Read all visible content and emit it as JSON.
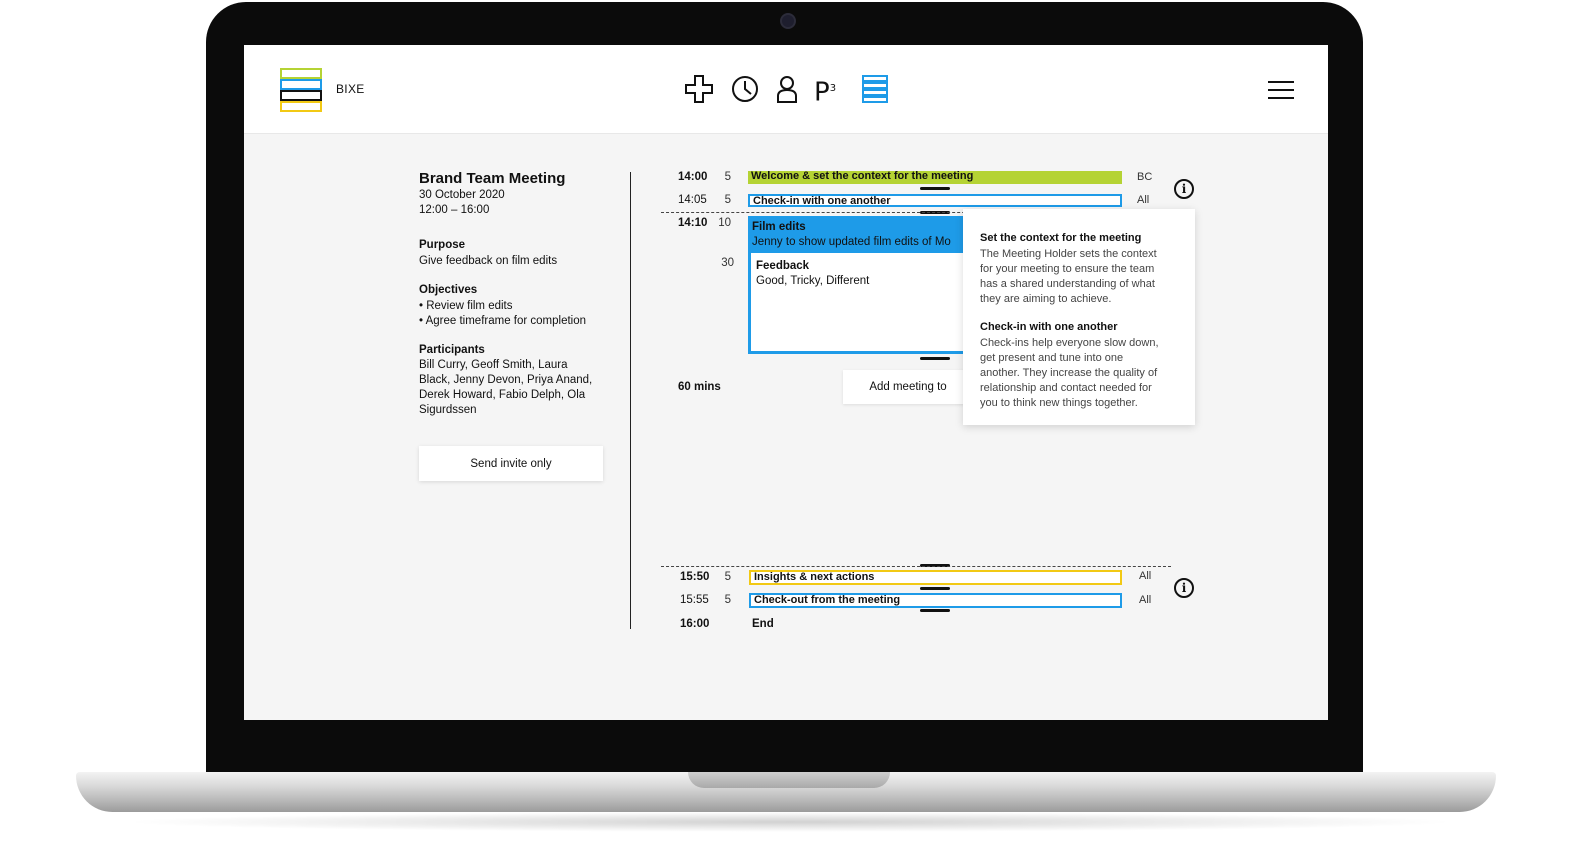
{
  "app": {
    "brand": "BIXE"
  },
  "nav": {
    "icons": [
      "plus-icon",
      "clock-icon",
      "person-icon",
      "p3-icon",
      "agenda-list-icon",
      "menu-icon"
    ],
    "p3_label": "P",
    "p3_sup": "3"
  },
  "meeting": {
    "title": "Brand Team Meeting",
    "date": "30 October 2020",
    "time_range": "12:00 – 16:00",
    "purpose_label": "Purpose",
    "purpose": "Give feedback on film edits",
    "objectives_label": "Objectives",
    "objectives": [
      "• Review film edits",
      "• Agree timeframe for completion"
    ],
    "participants_label": "Participants",
    "participants_lines": [
      "Bill Curry, Geoff Smith, Laura",
      "Black, Jenny Devon, Priya Anand,",
      "Derek Howard, Fabio Delph, Ola",
      "Sigurdssen"
    ],
    "send_invite": "Send invite only"
  },
  "agenda": {
    "items": [
      {
        "time": "14:00",
        "duration": "5",
        "title": "Welcome & set the context for the meeting",
        "who": "BC",
        "color": "#b5d334"
      },
      {
        "time": "14:05",
        "duration": "5",
        "title": "Check-in with one another",
        "who": "All",
        "color": "#1e9be8"
      }
    ],
    "film": {
      "time": "14:10",
      "duration": "10",
      "title": "Film edits",
      "subtitle": "Jenny to show updated film edits of Mo",
      "feedback_duration": "30",
      "feedback_title": "Feedback",
      "feedback_text": "Good, Tricky, Different"
    },
    "total": "60 mins",
    "add_button": "Add meeting to",
    "closing": [
      {
        "time": "15:50",
        "duration": "5",
        "title": "Insights & next actions",
        "who": "All",
        "color": "#f2c914"
      },
      {
        "time": "15:55",
        "duration": "5",
        "title": "Check-out from the meeting",
        "who": "All",
        "color": "#1e9be8"
      }
    ],
    "end_time": "16:00",
    "end_label": "End"
  },
  "tooltip": {
    "sections": [
      {
        "title": "Set the context for the meeting",
        "lines": [
          "The Meeting Holder sets the context",
          "for your meeting to ensure the team",
          "has a shared understanding of what",
          "they are aiming to achieve."
        ]
      },
      {
        "title": "Check-in with one another",
        "lines": [
          "Check-ins help everyone slow down,",
          "get present and tune into one",
          "another. They increase the quality of",
          "relationship and contact needed for",
          "you to think new things together."
        ]
      }
    ]
  },
  "colors": {
    "accent_blue": "#1e9be8",
    "accent_green": "#b5d334",
    "accent_yellow": "#f2c914"
  }
}
